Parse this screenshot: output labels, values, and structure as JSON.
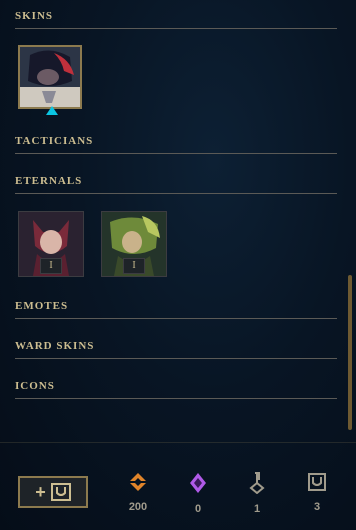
{
  "sections": {
    "skins": "SKINS",
    "tacticians": "TACTICIANS",
    "eternals": "ETERNALS",
    "emotes": "EMOTES",
    "ward_skins": "WARD SKINS",
    "icons": "ICONS"
  },
  "eternals": {
    "items": [
      {
        "level": "I"
      },
      {
        "level": "I"
      }
    ]
  },
  "footer": {
    "currencies": [
      {
        "icon": "orange-essence-icon",
        "amount": "200"
      },
      {
        "icon": "mythic-essence-icon",
        "amount": "0"
      },
      {
        "icon": "key-icon",
        "amount": "1"
      },
      {
        "icon": "chest-icon",
        "amount": "3"
      }
    ]
  },
  "colors": {
    "gold_border": "#8c7a4e",
    "text_gold": "#cdbe91",
    "orange_essence": "#e0842a",
    "mythic_essence": "#b05ae8",
    "blue_essence_gem": "#0bc6e3"
  }
}
